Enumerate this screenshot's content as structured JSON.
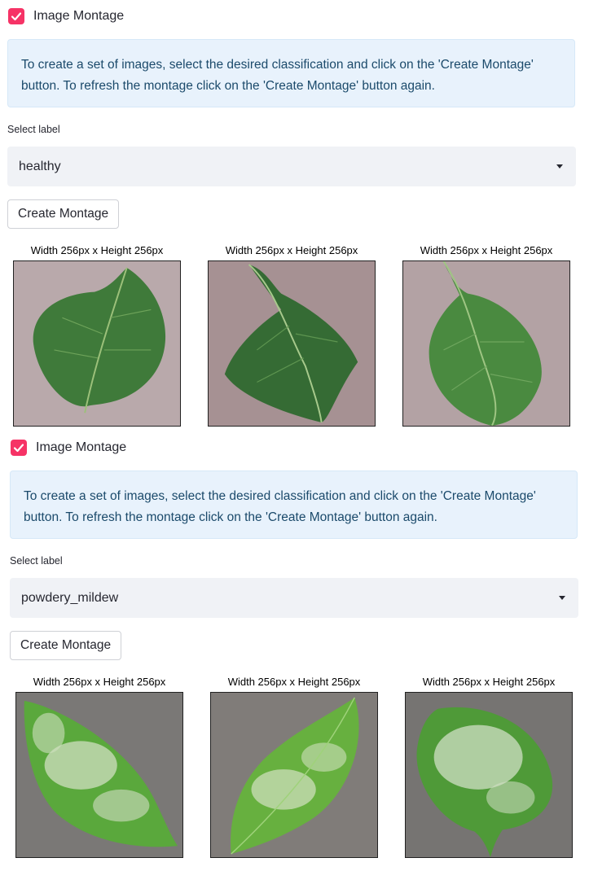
{
  "sections": [
    {
      "checkbox_label": "Image Montage",
      "info_text": "To create a set of images, select the desired classification and click on the 'Create Montage' button. To refresh the montage click on the 'Create Montage' button again.",
      "select_label": "Select label",
      "select_value": "healthy",
      "button_label": "Create Montage",
      "tiles": [
        {
          "title": "Width 256px x Height 256px"
        },
        {
          "title": "Width 256px x Height 256px"
        },
        {
          "title": "Width 256px x Height 256px"
        }
      ]
    },
    {
      "checkbox_label": "Image Montage",
      "info_text": "To create a set of images, select the desired classification and click on the 'Create Montage' button. To refresh the montage click on the 'Create Montage' button again.",
      "select_label": "Select label",
      "select_value": "powdery_mildew",
      "button_label": "Create Montage",
      "tiles": [
        {
          "title": "Width 256px x Height 256px"
        },
        {
          "title": "Width 256px x Height 256px"
        },
        {
          "title": "Width 256px x Height 256px"
        }
      ]
    }
  ],
  "colors": {
    "checkbox": "#f63366",
    "info_bg": "#e8f2fc",
    "info_text": "#1b4a6b",
    "select_bg": "#f0f2f6",
    "leaf_healthy": "#3f7a3a",
    "leaf_mildew": "#5aa83c",
    "background_healthy": "#b9a9ab",
    "background_mildew": "#7c7a78"
  }
}
